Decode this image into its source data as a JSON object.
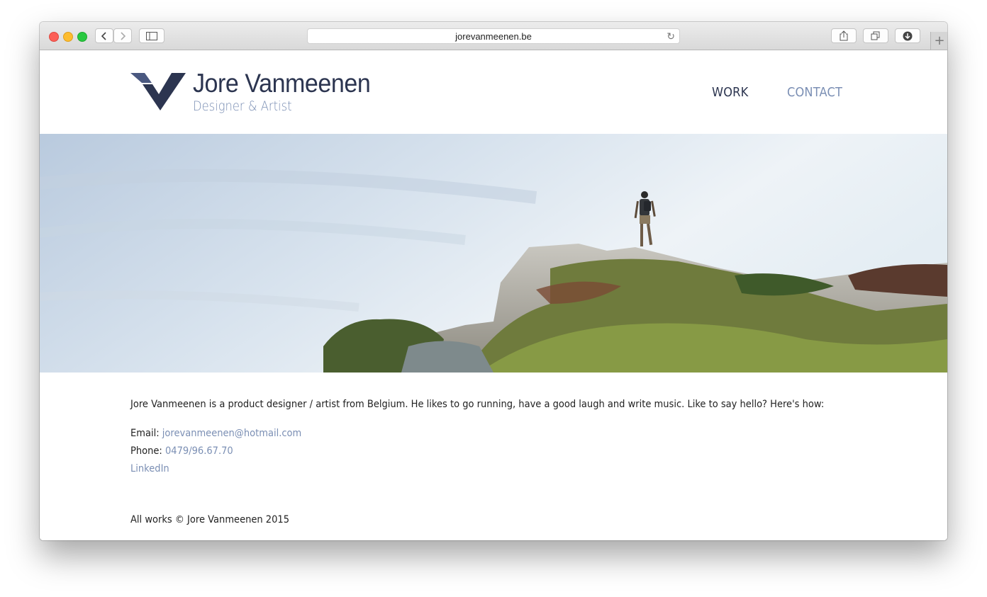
{
  "browser": {
    "url": "jorevanmeenen.be",
    "back_icon": "chevron-left-icon",
    "forward_icon": "chevron-right-icon",
    "new_tab_label": "+"
  },
  "site": {
    "name": "Jore Vanmeenen",
    "tagline": "Designer & Artist",
    "nav": [
      {
        "label": "WORK",
        "active": true
      },
      {
        "label": "CONTACT",
        "active": false
      }
    ]
  },
  "about": {
    "bio": "Jore Vanmeenen is a product designer / artist from Belgium. He likes to go running, have a good laugh and write music. Like to say hello? Here's how:",
    "email_label": "Email: ",
    "email": "jorevanmeenen@hotmail.com",
    "phone_label": "Phone: ",
    "phone": "0479/96.67.70",
    "linkedin": "LinkedIn"
  },
  "footer": {
    "text": "All works © Jore Vanmeenen 2015"
  },
  "colors": {
    "brand_dark": "#2c3550",
    "brand_light": "#7b8fb4"
  }
}
